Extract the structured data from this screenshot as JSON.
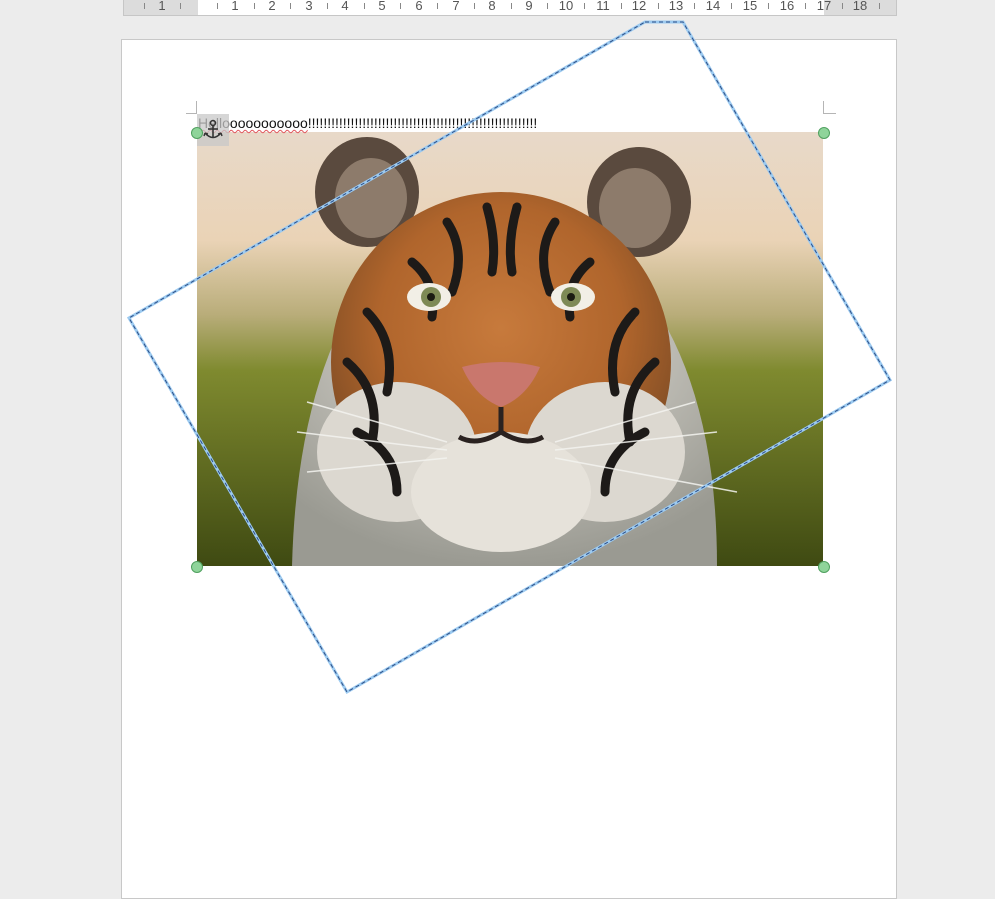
{
  "ruler": {
    "numbers": [
      "1",
      "1",
      "2",
      "3",
      "4",
      "5",
      "6",
      "7",
      "8",
      "9",
      "10",
      "11",
      "12",
      "13",
      "14",
      "15",
      "16",
      "17",
      "18"
    ]
  },
  "document": {
    "text_prefix": "Hellooooooooooo",
    "text_suffix": "!!!!!!!!!!!!!!!!!!!!!!!!!!!!!!!!!!!!!!!!!!!!!!!!!!!!!!!!!!!"
  },
  "picture": {
    "subject": "tiger-face-photo",
    "background_top": "#eadbc9",
    "background_bottom": "#6e7d24",
    "selection_color": "#8fd49a",
    "shape_outline_color": "#6aa6d6"
  },
  "icons": {
    "anchor": "anchor-icon",
    "handle": "resize-handle-icon"
  }
}
